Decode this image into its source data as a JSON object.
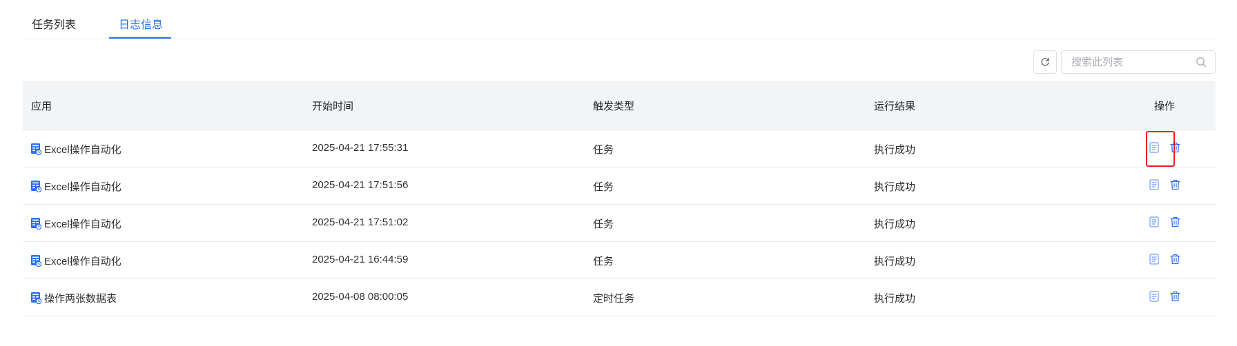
{
  "tabs": [
    {
      "label": "任务列表",
      "active": false
    },
    {
      "label": "日志信息",
      "active": true
    }
  ],
  "toolbar": {
    "search_placeholder": "搜索此列表",
    "search_value": ""
  },
  "table": {
    "headers": [
      "应用",
      "开始时间",
      "触发类型",
      "运行结果",
      "操作"
    ],
    "rows": [
      {
        "app": "Excel操作自动化",
        "start_time": "2025-04-21 17:55:31",
        "trigger": "任务",
        "result": "执行成功"
      },
      {
        "app": "Excel操作自动化",
        "start_time": "2025-04-21 17:51:56",
        "trigger": "任务",
        "result": "执行成功"
      },
      {
        "app": "Excel操作自动化",
        "start_time": "2025-04-21 17:51:02",
        "trigger": "任务",
        "result": "执行成功"
      },
      {
        "app": "Excel操作自动化",
        "start_time": "2025-04-21 16:44:59",
        "trigger": "任务",
        "result": "执行成功"
      },
      {
        "app": "操作两张数据表",
        "start_time": "2025-04-08 08:00:05",
        "trigger": "定时任务",
        "result": "执行成功"
      }
    ]
  },
  "icons": {
    "app": "excel-app-icon",
    "view_log": "document-icon",
    "delete": "trash-icon",
    "refresh": "refresh-icon",
    "search": "search-icon"
  },
  "colors": {
    "accent": "#2b6ef6",
    "highlight": "#ee1c1c",
    "header_bg": "#f3f4f6"
  }
}
